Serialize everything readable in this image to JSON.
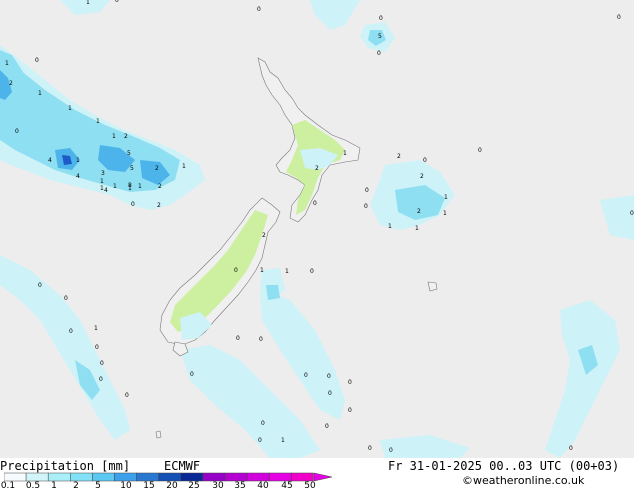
{
  "footer": {
    "title": "Precipitation [mm]",
    "model": "ECMWF",
    "valid_time": "Fr 31-01-2025 00..03 UTC (00+03)",
    "credit": "©weatheronline.co.uk"
  },
  "legend": {
    "ticks": [
      "0.1",
      "0.5",
      "1",
      "2",
      "5",
      "10",
      "15",
      "20",
      "25",
      "30",
      "35",
      "40",
      "45",
      "50"
    ],
    "colors": [
      "#f5fbff",
      "#d2f5fa",
      "#aaeef7",
      "#82e1f5",
      "#5ac8f0",
      "#3ca0eb",
      "#2878d2",
      "#1450b4",
      "#0a2896",
      "#9600c8",
      "#b400d2",
      "#d200dc",
      "#e600e6",
      "#f000c8"
    ]
  },
  "map": {
    "colors": {
      "sea": "#ededed",
      "land": "#f0f0f0",
      "land_wet": "#ccf0a0",
      "precip_light": "#cdf2f7",
      "precip_mid": "#8fdff2",
      "precip_heavy": "#4cb4ea",
      "precip_max": "#1e5ac8"
    },
    "labels": [
      "1",
      "0",
      "0",
      "5",
      "0",
      "1",
      "0",
      "2",
      "0",
      "1",
      "1",
      "1",
      "2",
      "4",
      "1",
      "3",
      "5",
      "2",
      "1",
      "4",
      "1",
      "5",
      "8",
      "1",
      "2",
      "1",
      "1",
      "4",
      "1",
      "1",
      "0",
      "2",
      "1",
      "2",
      "0",
      "0",
      "2",
      "0",
      "2",
      "1",
      "0",
      "2",
      "1",
      "1",
      "0",
      "1",
      "0",
      "0",
      "0",
      "2",
      "0",
      "1",
      "1",
      "0",
      "0",
      "0",
      "1",
      "0",
      "0",
      "0",
      "0",
      "0",
      "0",
      "0",
      "0",
      "0",
      "0",
      "0",
      "0",
      "0",
      "0",
      "0",
      "0",
      "1",
      "0",
      "0",
      "0"
    ]
  }
}
